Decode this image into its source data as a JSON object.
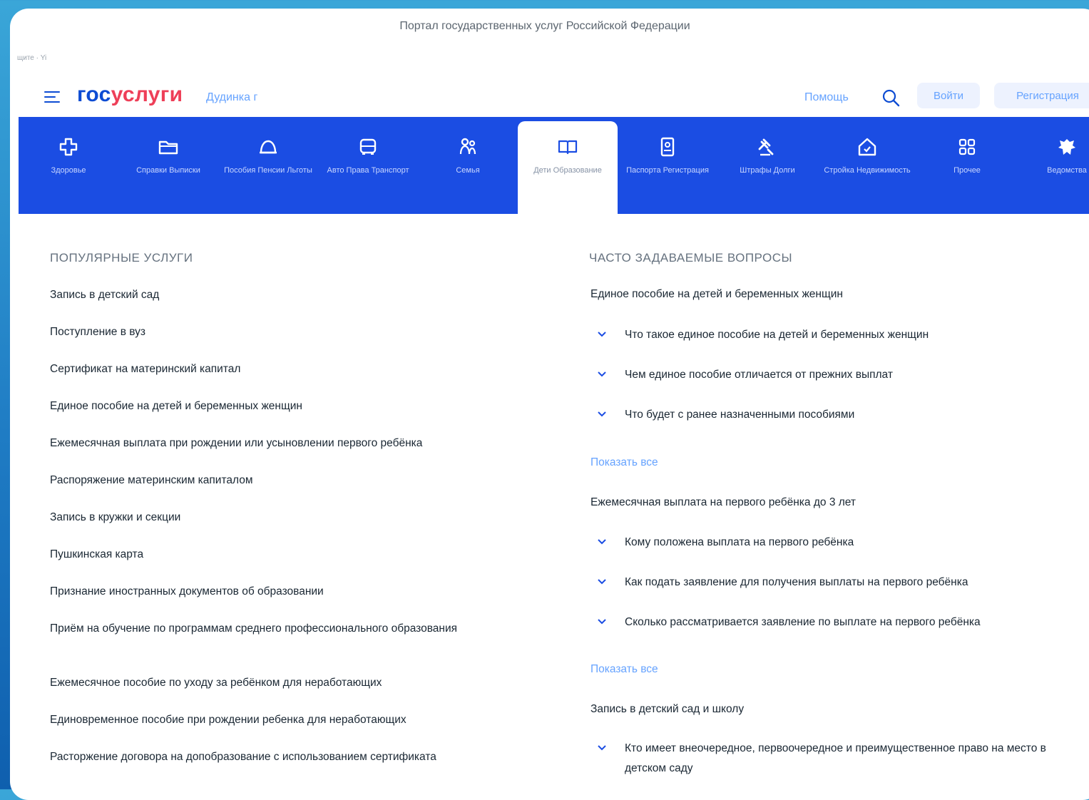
{
  "window": {
    "title": "Портал государственных услуг Российской Федерации",
    "crumb": "щите · Yi"
  },
  "header": {
    "logo_part1": "гос",
    "logo_part2": "услуги",
    "city": "Дудинка г",
    "help": "Помощь",
    "login": "Войти",
    "register": "Регистрация"
  },
  "categories": [
    {
      "icon": "health-icon",
      "label": "Здоровье"
    },
    {
      "icon": "folder-icon",
      "label": "Справки Выписки"
    },
    {
      "icon": "benefits-icon",
      "label": "Пособия Пенсии Льготы"
    },
    {
      "icon": "car-icon",
      "label": "Авто Права Транспорт"
    },
    {
      "icon": "family-icon",
      "label": "Семья"
    },
    {
      "icon": "book-icon",
      "label": "Дети Образование",
      "active": true
    },
    {
      "icon": "passport-icon",
      "label": "Паспорта Регистрация"
    },
    {
      "icon": "gavel-icon",
      "label": "Штрафы Долги"
    },
    {
      "icon": "house-icon",
      "label": "Стройка Недвижимость"
    },
    {
      "icon": "grid-icon",
      "label": "Прочее"
    },
    {
      "icon": "emblem-icon",
      "label": "Ведомства"
    }
  ],
  "popular": {
    "title": "ПОПУЛЯРНЫЕ УСЛУГИ",
    "items": [
      "Запись в детский сад",
      "Поступление в вуз",
      "Сертификат на материнский капитал",
      "Единое пособие на детей и беременных женщин",
      "Ежемесячная выплата при рождении или усыновлении первого ребёнка",
      "Распоряжение материнским капиталом",
      "Запись в кружки и секции",
      "Пушкинская карта",
      "Признание иностранных документов об образовании",
      "Приём на обучение по программам среднего профессионального образования",
      "Ежемесячное пособие по уходу за ребёнком для неработающих",
      "Единовременное пособие при рождении ребенка для неработающих",
      "Расторжение договора на допобразование с использованием сертификата"
    ]
  },
  "faq": {
    "title": "ЧАСТО ЗАДАВАЕМЫЕ ВОПРОСЫ",
    "show_all": "Показать все",
    "groups": [
      {
        "heading": "Единое пособие на детей и беременных женщин",
        "questions": [
          "Что такое единое пособие на детей и беременных женщин",
          "Чем единое пособие отличается от прежних выплат",
          "Что будет с ранее назначенными пособиями"
        ]
      },
      {
        "heading": "Ежемесячная выплата на первого ребёнка до 3 лет",
        "questions": [
          "Кому положена выплата на первого ребёнка",
          "Как подать заявление для получения выплаты на первого ребёнка",
          "Сколько рассматривается заявление по выплате на первого ребёнка"
        ]
      },
      {
        "heading": "Запись в детский сад и школу",
        "questions": [
          "Кто имеет внеочередное, первоочередное и преимущественное право на место в детском саду"
        ]
      }
    ]
  },
  "colors": {
    "brand_blue": "#0d4cd3",
    "brand_red": "#ee3f58",
    "nav_blue": "#1b4de3",
    "link": "#66a3ff"
  }
}
